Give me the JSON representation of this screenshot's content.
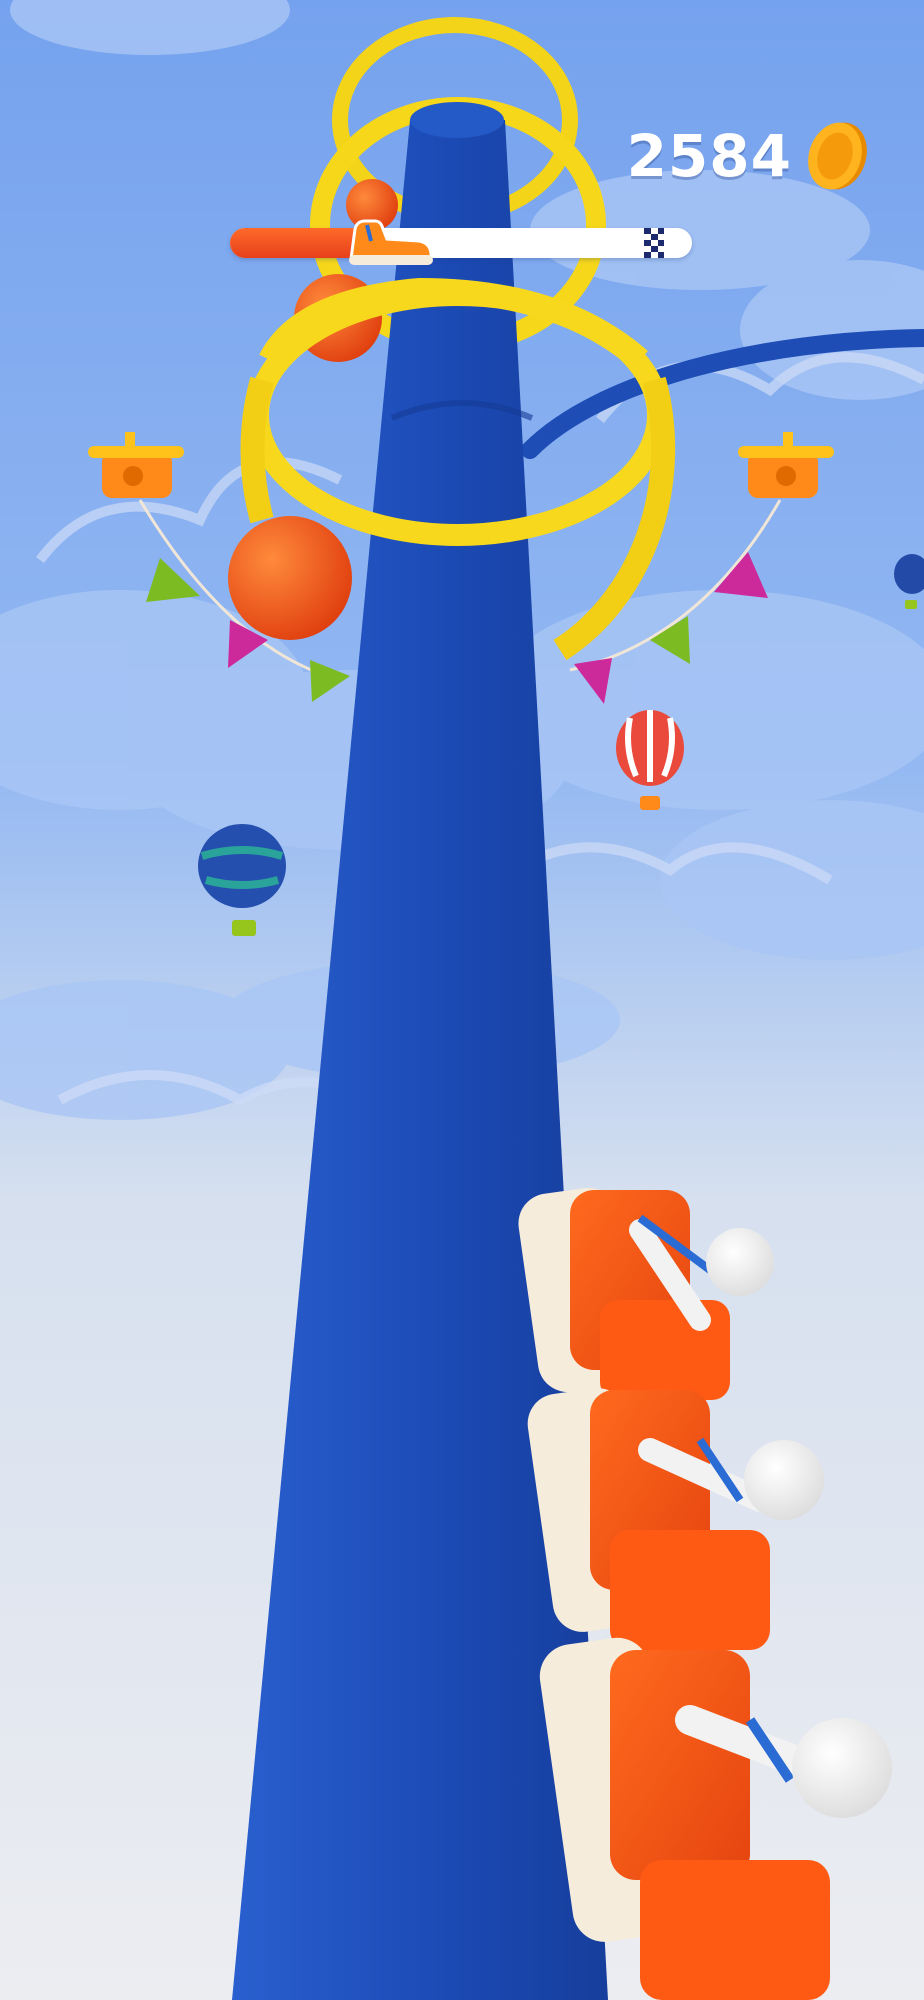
{
  "hud": {
    "coins": "2584",
    "level_progress": 0.3
  },
  "colors": {
    "sky_top": "#7fa9ef",
    "sky_bottom": "#e9ecf1",
    "track": "#1e4fb8",
    "rings": "#f7d81c",
    "cart": "#ff5a14",
    "seat": "#f5ecdc",
    "progress_fill": "#e7401a"
  },
  "icons": [
    "coin-icon",
    "cart-icon",
    "finish-flag-icon",
    "biplane-icon",
    "hot-air-balloon-icon"
  ]
}
